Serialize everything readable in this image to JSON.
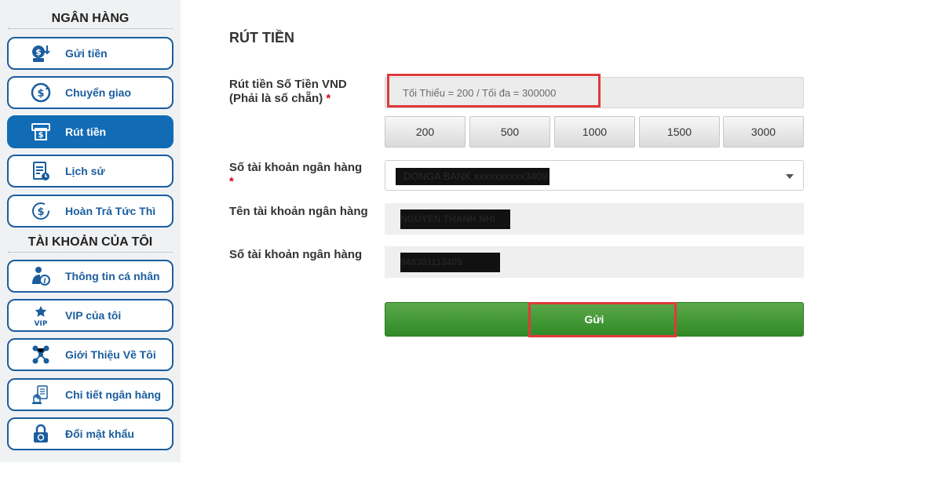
{
  "sidebar": {
    "banking_title": "NGÂN HÀNG",
    "account_title": "TÀI KHOẢN CỦA TÔI",
    "banking_items": [
      {
        "label": "Gửi tiền",
        "icon": "deposit-icon"
      },
      {
        "label": "Chuyển giao",
        "icon": "transfer-icon"
      },
      {
        "label": "Rút tiền",
        "icon": "withdraw-icon",
        "active": true
      },
      {
        "label": "Lịch sử",
        "icon": "history-icon"
      },
      {
        "label": "Hoàn Trả Tức Thì",
        "icon": "rebate-icon"
      }
    ],
    "account_items": [
      {
        "label": "Thông tin cá nhân",
        "icon": "profile-icon"
      },
      {
        "label": "VIP của tôi",
        "icon": "vip-icon"
      },
      {
        "label": "Giới Thiệu Về Tôi",
        "icon": "referral-icon"
      },
      {
        "label": "Chi tiết ngân hàng",
        "icon": "bank-details-icon"
      },
      {
        "label": "Đổi mật khẩu",
        "icon": "change-password-icon"
      }
    ]
  },
  "main": {
    "title": "RÚT TIỀN",
    "amount": {
      "label_line1": "Rút tiền Số Tiền VND",
      "label_line2": "(Phải là số chẵn)",
      "required": "*",
      "placeholder": "Tối Thiểu = 200 / Tối đa = 300000"
    },
    "quick_amounts": [
      "200",
      "500",
      "1000",
      "1500",
      "3000"
    ],
    "bank_account": {
      "label": "Số tài khoản ngân hàng",
      "required": "*",
      "selected": "DONGA BANK xxxxxxxxxx3409"
    },
    "account_name": {
      "label": "Tên tài khoản ngân hàng",
      "value": "NGUYEN THANH NHI"
    },
    "account_number": {
      "label": "Số tài khoản ngân hàng",
      "value": "048301113409"
    },
    "submit_label": "Gửi"
  },
  "colors": {
    "accent": "#116bb5",
    "submit": "#3d952f",
    "highlight": "#e0393a"
  }
}
